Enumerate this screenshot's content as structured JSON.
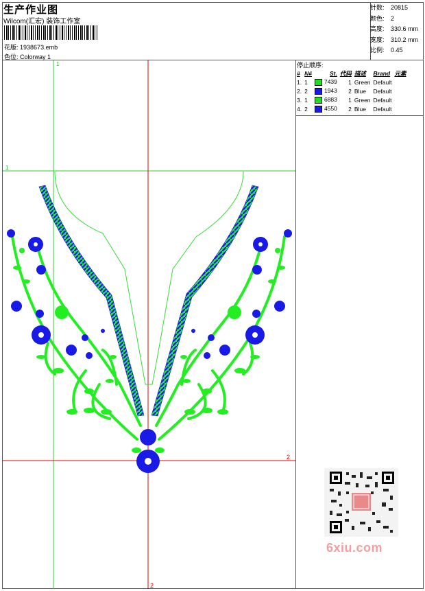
{
  "header": {
    "title": "生产作业图",
    "studio": "Wilcom(汇宏) 装饰工作室",
    "pattern_label": "花版:",
    "pattern_value": "1938673.emb",
    "colorway_label": "色位:",
    "colorway_value": "Colorway 1"
  },
  "stats": [
    {
      "label": "针数:",
      "value": "20815"
    },
    {
      "label": "颜色:",
      "value": "2"
    },
    {
      "label": "高度:",
      "value": "330.6 mm"
    },
    {
      "label": "宽度:",
      "value": "310.2 mm"
    },
    {
      "label": "比例:",
      "value": "0.45"
    }
  ],
  "stop_sequence": {
    "title": "停止顺序:",
    "headers": [
      "#",
      "N#",
      "St.",
      "代码",
      "描述",
      "Brand",
      "元素"
    ],
    "rows": [
      {
        "idx": "1.",
        "n": "1",
        "st": "7439",
        "code": "1",
        "desc": "Green",
        "brand": "Default",
        "color": "#22dd22"
      },
      {
        "idx": "2.",
        "n": "2",
        "st": "1943",
        "code": "2",
        "desc": "Blue",
        "brand": "Default",
        "color": "#1a1ae6"
      },
      {
        "idx": "3.",
        "n": "1",
        "st": "6883",
        "code": "1",
        "desc": "Green",
        "brand": "Default",
        "color": "#22dd22"
      },
      {
        "idx": "4.",
        "n": "2",
        "st": "4550",
        "code": "2",
        "desc": "Blue",
        "brand": "Default",
        "color": "#1a1ae6"
      }
    ]
  },
  "guides": {
    "green_v": "1",
    "green_h": "1",
    "red_v": "2",
    "red_h": "2"
  },
  "watermark": "6xiu.com",
  "colors": {
    "green": "#22ee22",
    "blue": "#1a1ae6",
    "guide_red": "#dd0000",
    "guide_green": "#33cc33"
  }
}
